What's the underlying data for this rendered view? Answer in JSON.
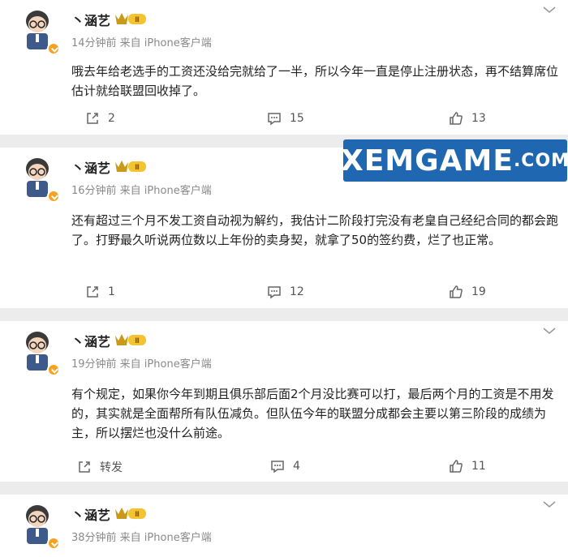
{
  "comments": [
    {
      "username": "丶涵艺",
      "level": "Ⅱ",
      "meta": "14分钟前 来自 iPhone客户端",
      "text": "哦去年给老选手的工资还没给完就给了一半，所以今年一直是停止注册状态，再不结算席位估计就给联盟回收掉了。",
      "share": "2",
      "comment": "15",
      "like": "13"
    },
    {
      "username": "丶涵艺",
      "level": "Ⅱ",
      "meta": "16分钟前 来自 iPhone客户端",
      "text": "还有超过三个月不发工资自动视为解约，我估计二阶段打完没有老皇自己经纪合同的都会跑了。打野最久听说两位数以上年份的卖身契，就拿了50的签约费，烂了也正常。",
      "share": "1",
      "comment": "12",
      "like": "19"
    },
    {
      "username": "丶涵艺",
      "level": "Ⅱ",
      "meta": "19分钟前 来自 iPhone客户端",
      "text": "有个规定，如果你今年到期且俱乐部后面2个月没比赛可以打，最后两个月的工资是不用发的，其实就是全面帮所有队伍减负。但队伍今年的联盟分成都会主要以第三阶段的成绩为主，所以摆烂也没什么前途。",
      "share": "转发",
      "comment": "4",
      "like": "11"
    },
    {
      "username": "丶涵艺",
      "level": "Ⅱ",
      "meta": "38分钟前 来自 iPhone客户端"
    }
  ],
  "watermark": {
    "main": "XEMGAME",
    "suffix": ".COM"
  },
  "colors": {
    "background": "#ececec",
    "card": "#ffffff",
    "badge": "#f6a21e",
    "watermark": "#1f67b1"
  }
}
